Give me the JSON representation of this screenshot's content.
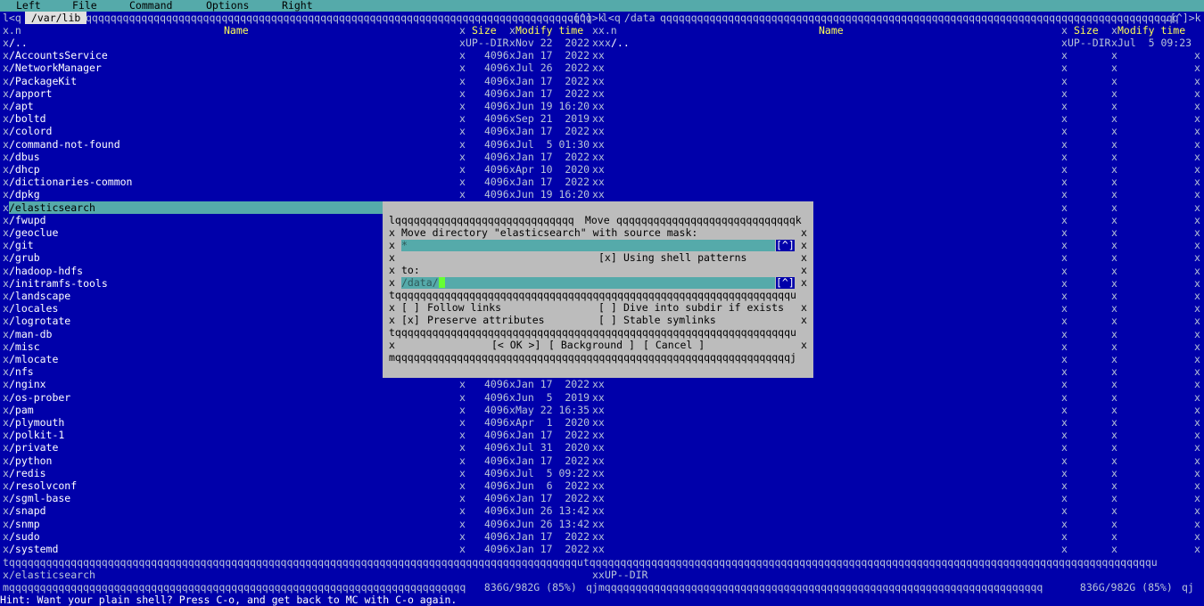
{
  "menubar": {
    "left": "Left",
    "file": "File",
    "command": "Command",
    "options": "Options",
    "right": "Right"
  },
  "left_panel": {
    "path": " /var/lib ",
    "header_name": "Name",
    "header_size": "Size",
    "header_mtime": "Modify time",
    "hist_marker": ".[^]>k",
    "rows": [
      {
        "name": "/..",
        "size": "UP--DIR",
        "mtime": "Nov 22  2022"
      },
      {
        "name": "/AccountsService",
        "size": "4096",
        "mtime": "Jan 17  2022"
      },
      {
        "name": "/NetworkManager",
        "size": "4096",
        "mtime": "Jul 26  2022"
      },
      {
        "name": "/PackageKit",
        "size": "4096",
        "mtime": "Jan 17  2022"
      },
      {
        "name": "/apport",
        "size": "4096",
        "mtime": "Jan 17  2022"
      },
      {
        "name": "/apt",
        "size": "4096",
        "mtime": "Jun 19 16:20"
      },
      {
        "name": "/boltd",
        "size": "4096",
        "mtime": "Sep 21  2019"
      },
      {
        "name": "/colord",
        "size": "4096",
        "mtime": "Jan 17  2022"
      },
      {
        "name": "/command-not-found",
        "size": "4096",
        "mtime": "Jul  5 01:30"
      },
      {
        "name": "/dbus",
        "size": "4096",
        "mtime": "Jan 17  2022"
      },
      {
        "name": "/dhcp",
        "size": "4096",
        "mtime": "Apr 10  2020"
      },
      {
        "name": "/dictionaries-common",
        "size": "4096",
        "mtime": "Jan 17  2022"
      },
      {
        "name": "/dpkg",
        "size": "4096",
        "mtime": "Jun 19 16:20"
      },
      {
        "name": "/elasticsearch",
        "size": "",
        "mtime": "",
        "selected": true
      },
      {
        "name": "/fwupd",
        "size": "",
        "mtime": ""
      },
      {
        "name": "/geoclue",
        "size": "",
        "mtime": ""
      },
      {
        "name": "/git",
        "size": "",
        "mtime": ""
      },
      {
        "name": "/grub",
        "size": "",
        "mtime": ""
      },
      {
        "name": "/hadoop-hdfs",
        "size": "",
        "mtime": ""
      },
      {
        "name": "/initramfs-tools",
        "size": "",
        "mtime": ""
      },
      {
        "name": "/landscape",
        "size": "",
        "mtime": ""
      },
      {
        "name": "/locales",
        "size": "",
        "mtime": ""
      },
      {
        "name": "/logrotate",
        "size": "",
        "mtime": ""
      },
      {
        "name": "/man-db",
        "size": "",
        "mtime": ""
      },
      {
        "name": "/misc",
        "size": "",
        "mtime": ""
      },
      {
        "name": "/mlocate",
        "size": "",
        "mtime": ""
      },
      {
        "name": "/nfs",
        "size": "",
        "mtime": ""
      },
      {
        "name": "/nginx",
        "size": "4096",
        "mtime": "Jan 17  2022"
      },
      {
        "name": "/os-prober",
        "size": "4096",
        "mtime": "Jun  5  2019"
      },
      {
        "name": "/pam",
        "size": "4096",
        "mtime": "May 22 16:35"
      },
      {
        "name": "/plymouth",
        "size": "4096",
        "mtime": "Apr  1  2020"
      },
      {
        "name": "/polkit-1",
        "size": "4096",
        "mtime": "Jan 17  2022"
      },
      {
        "name": "/private",
        "size": "4096",
        "mtime": "Jul 31  2020"
      },
      {
        "name": "/python",
        "size": "4096",
        "mtime": "Jan 17  2022"
      },
      {
        "name": "/redis",
        "size": "4096",
        "mtime": "Jul  5 09:22"
      },
      {
        "name": "/resolvconf",
        "size": "4096",
        "mtime": "Jun  6  2022"
      },
      {
        "name": "/sgml-base",
        "size": "4096",
        "mtime": "Jan 17  2022"
      },
      {
        "name": "/snapd",
        "size": "4096",
        "mtime": "Jun 26 13:42"
      },
      {
        "name": "/snmp",
        "size": "4096",
        "mtime": "Jun 26 13:42"
      },
      {
        "name": "/sudo",
        "size": "4096",
        "mtime": "Jan 17  2022"
      },
      {
        "name": "/systemd",
        "size": "4096",
        "mtime": "Jan 17  2022"
      }
    ],
    "status_name": "/elasticsearch",
    "status_size": "UP--DIR",
    "disk": " 836G/982G (85%) "
  },
  "right_panel": {
    "path": " /data ",
    "header_name": "Name",
    "header_size": "Size",
    "header_mtime": "Modify time",
    "hist_marker": ".[^]>k",
    "rows": [
      {
        "name": "/..",
        "size": "UP--DIR",
        "mtime": "Jul  5 09:23"
      }
    ],
    "disk": " 836G/982G (85%) "
  },
  "dialog": {
    "title": " Move ",
    "source_label": "Move directory \"elasticsearch\" with source mask:",
    "source_value": "*",
    "hist_button": "[^]",
    "shell_patterns_check": "[x]",
    "shell_patterns_label": "Using shell patterns",
    "to_label": "to:",
    "dest_value": "/data/",
    "follow_links_check": "[ ]",
    "follow_links_label": "Follow links",
    "dive_check": "[ ]",
    "dive_label": "Dive into subdir if exists",
    "preserve_check": "[x]",
    "preserve_label": "Preserve attributes",
    "stable_check": "[ ]",
    "stable_label": "Stable symlinks",
    "ok_label": "[< OK >]",
    "background_label": "[ Background ]",
    "cancel_label": "[ Cancel ]"
  },
  "hint": "Hint: Want your plain shell? Press C-o, and get back to MC with C-o again."
}
